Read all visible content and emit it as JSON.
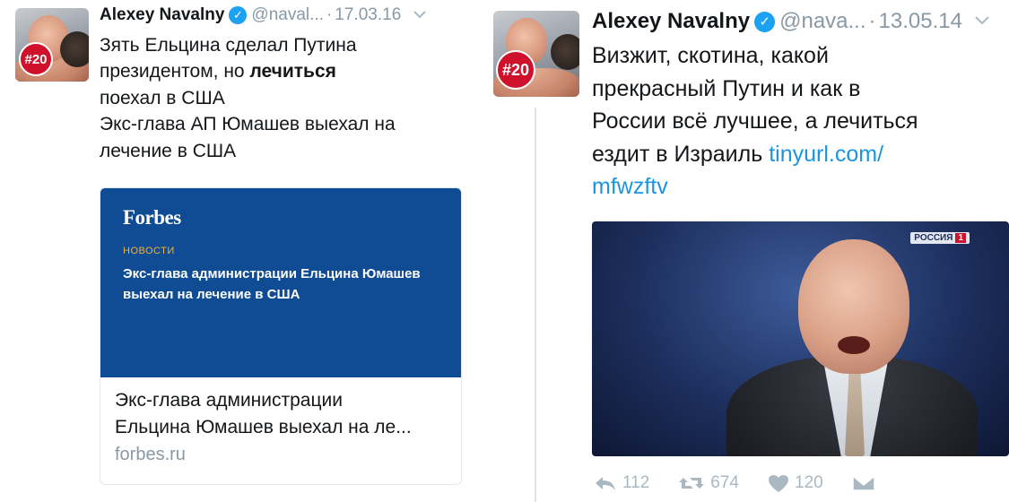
{
  "left_tweet": {
    "author_name": "Alexey Navalny",
    "handle": "@naval...",
    "date": "17.03.16",
    "avatar_badge": "#20",
    "text_lines": [
      {
        "before": "Зять Ельцина сделал Путина",
        "bold": "",
        "after": ""
      },
      {
        "before": "президентом, но ",
        "bold": "лечиться",
        "after": ""
      },
      {
        "before": "поехал в США",
        "bold": "",
        "after": ""
      },
      {
        "before": "Экс-глава АП Юмашев выехал на",
        "bold": "",
        "after": ""
      },
      {
        "before": "лечение в США",
        "bold": "",
        "after": ""
      }
    ],
    "card": {
      "brand": "Forbes",
      "section": "НОВОСТИ",
      "headline": "Экс-глава администрации Ельцина Юмашев выехал на лечение в США",
      "title_line1": "Экс-глава администрации",
      "title_line2": "Ельцина Юмашев выехал на ле...",
      "domain": "forbes.ru"
    }
  },
  "right_tweet": {
    "author_name": "Alexey Navalny",
    "handle": "@nava...",
    "date": "13.05.14",
    "avatar_badge": "#20",
    "text_lines": [
      "Визжит, скотина, какой",
      "прекрасный Путин и как в",
      "России всё лучшее, а лечиться"
    ],
    "text_last_prefix": "ездит в Израиль ",
    "link_part1": "tinyurl.com/",
    "link_part2": "mfwzftv",
    "media_logo": "РОССИЯ",
    "media_logo_num": "1",
    "actions": {
      "reply_count": "112",
      "retweet_count": "674",
      "like_count": "120"
    }
  },
  "colors": {
    "link": "#1b95e0",
    "verified": "#1da1f2",
    "muted": "#8899a6",
    "forbes_bg": "#0f4c93",
    "badge_red": "#d0112b"
  }
}
